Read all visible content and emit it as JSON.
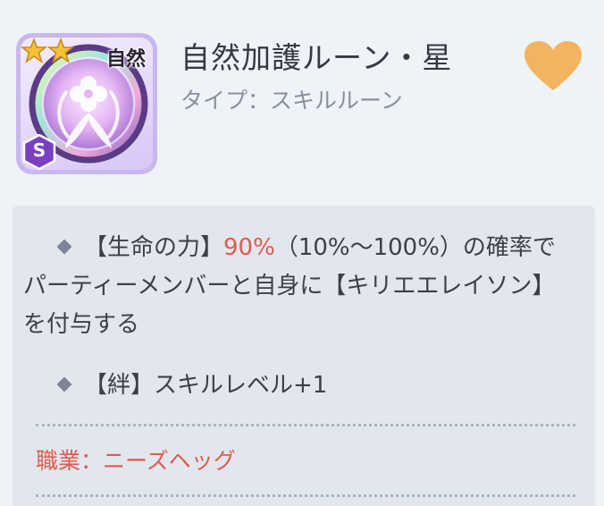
{
  "rune": {
    "attribute_tag": "自然",
    "rank": "S",
    "star_count": 2,
    "title": "自然加護ルーン・星",
    "type_label": "タイプ：スキルルーン",
    "favorite_icon": "heart-icon",
    "colors": {
      "heart": "#f4b35f",
      "highlight": "#e05a4e",
      "frame": "#c9b7ee"
    }
  },
  "effects": [
    {
      "prefix": "【生命の力】",
      "highlight": "90%",
      "rest": "（10%～100%）の確率でパーティーメンバーと自身に【キリエエレイソン】を付与する"
    },
    {
      "text": "【絆】スキルレベル+1"
    }
  ],
  "job": "職業：ニーズヘッグ"
}
